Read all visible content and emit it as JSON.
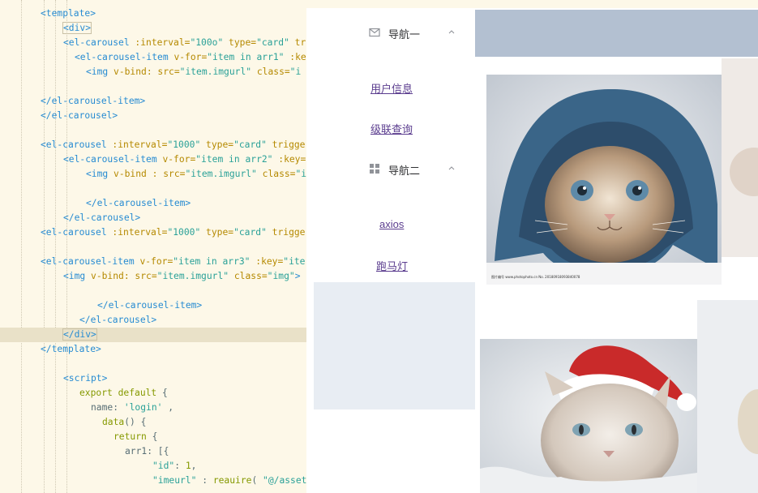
{
  "editor": {
    "lines": [
      [
        [
          "tag",
          "<template>"
        ]
      ],
      [
        [
          "tagbox",
          "<div>"
        ]
      ],
      [
        [
          "tag",
          "<el-carousel "
        ],
        [
          "attr",
          ":interval="
        ],
        [
          "str",
          "\"100o\""
        ],
        [
          "attr",
          " type="
        ],
        [
          "str",
          "\"card\""
        ],
        [
          "attr",
          " tr"
        ]
      ],
      [
        [
          "tag",
          "<el-carousel-item "
        ],
        [
          "attr",
          "v-for="
        ],
        [
          "str",
          "\"item in arr1\""
        ],
        [
          "attr",
          " :ke"
        ]
      ],
      [
        [
          "tag",
          "<img "
        ],
        [
          "attr",
          "v-bind: src="
        ],
        [
          "str",
          "\"item.imgurl\""
        ],
        [
          "attr",
          " class="
        ],
        [
          "str",
          "\"i"
        ]
      ],
      [],
      [
        [
          "tag",
          "</el-carousel-item>"
        ]
      ],
      [
        [
          "tag",
          "</el-carousel>"
        ]
      ],
      [],
      [
        [
          "tag",
          "<el-carousel "
        ],
        [
          "attr",
          ":interval="
        ],
        [
          "str",
          "\"1000\""
        ],
        [
          "attr",
          " type="
        ],
        [
          "str",
          "\"card\""
        ],
        [
          "attr",
          " trigge"
        ]
      ],
      [
        [
          "tag",
          "<el-carousel-item "
        ],
        [
          "attr",
          "v-for="
        ],
        [
          "str",
          "\"item in arr2\""
        ],
        [
          "attr",
          " :key="
        ]
      ],
      [
        [
          "tag",
          "<img "
        ],
        [
          "attr",
          "v-bind : src="
        ],
        [
          "str",
          "\"item.imgurl\""
        ],
        [
          "attr",
          " class="
        ],
        [
          "str",
          "\"i"
        ]
      ],
      [],
      [
        [
          "tag",
          "</el-carousel-item>"
        ]
      ],
      [
        [
          "tag",
          "</el-carousel>"
        ]
      ],
      [
        [
          "tag",
          "<el-carousel "
        ],
        [
          "attr",
          ":interval="
        ],
        [
          "str",
          "\"1000\""
        ],
        [
          "attr",
          " type="
        ],
        [
          "str",
          "\"card\""
        ],
        [
          "attr",
          " trigge"
        ]
      ],
      [],
      [
        [
          "tag",
          "<el-carousel-item "
        ],
        [
          "attr",
          "v-for="
        ],
        [
          "str",
          "\"item in arr3\""
        ],
        [
          "attr",
          " :key="
        ],
        [
          "str",
          "\"ite"
        ]
      ],
      [
        [
          "tag",
          "<img "
        ],
        [
          "attr",
          "v-bind: src="
        ],
        [
          "str",
          "\"item.imgurl\""
        ],
        [
          "attr",
          " class="
        ],
        [
          "str",
          "\"img\""
        ],
        [
          "tag",
          ">"
        ]
      ],
      [],
      [
        [
          "tag",
          "</el-carousel-item>"
        ]
      ],
      [
        [
          "tag",
          "</el-carousel>"
        ]
      ],
      [
        [
          "tagbox",
          "</div>"
        ]
      ],
      [
        [
          "tag",
          "</template>"
        ]
      ],
      [],
      [
        [
          "tag",
          "<script>"
        ]
      ],
      [
        [
          "kw",
          "export default"
        ],
        [
          "plain",
          " {"
        ]
      ],
      [
        [
          "plain",
          "name: "
        ],
        [
          "str",
          "'login'"
        ],
        [
          "plain",
          " ,"
        ]
      ],
      [
        [
          "kw",
          "data"
        ],
        [
          "plain",
          "() {"
        ]
      ],
      [
        [
          "kw",
          "return"
        ],
        [
          "plain",
          " {"
        ]
      ],
      [
        [
          "plain",
          "arr1: [{"
        ]
      ],
      [
        [
          "str",
          "\"id\""
        ],
        [
          "plain",
          ": "
        ],
        [
          "kw",
          "1"
        ],
        [
          "plain",
          ","
        ]
      ],
      [
        [
          "str",
          "\"imeurl\""
        ],
        [
          "plain",
          " : "
        ],
        [
          "kw",
          "reauire"
        ],
        [
          "plain",
          "( "
        ],
        [
          "str",
          "\"@/asset"
        ]
      ]
    ]
  },
  "sidebar": {
    "groups": [
      {
        "title": "导航一",
        "icon": "mail-icon",
        "items": [
          "用户信息",
          "级联查询"
        ]
      },
      {
        "title": "导航二",
        "icon": "grid-icon",
        "items": [
          "axios",
          "跑马灯"
        ]
      }
    ]
  },
  "main": {
    "photos": [
      {
        "subject": "kitten-in-denim-hood",
        "caption": "图片编号 www.photophoto.cn  No. 20180918093840078"
      },
      {
        "subject": "cat-in-santa-hat",
        "caption": ""
      }
    ]
  },
  "colors": {
    "editor_bg": "#fdf8e8",
    "header_bg": "#b3c0d1",
    "sidebar_bg": "#e8edf3",
    "link": "#5b3d8f"
  }
}
